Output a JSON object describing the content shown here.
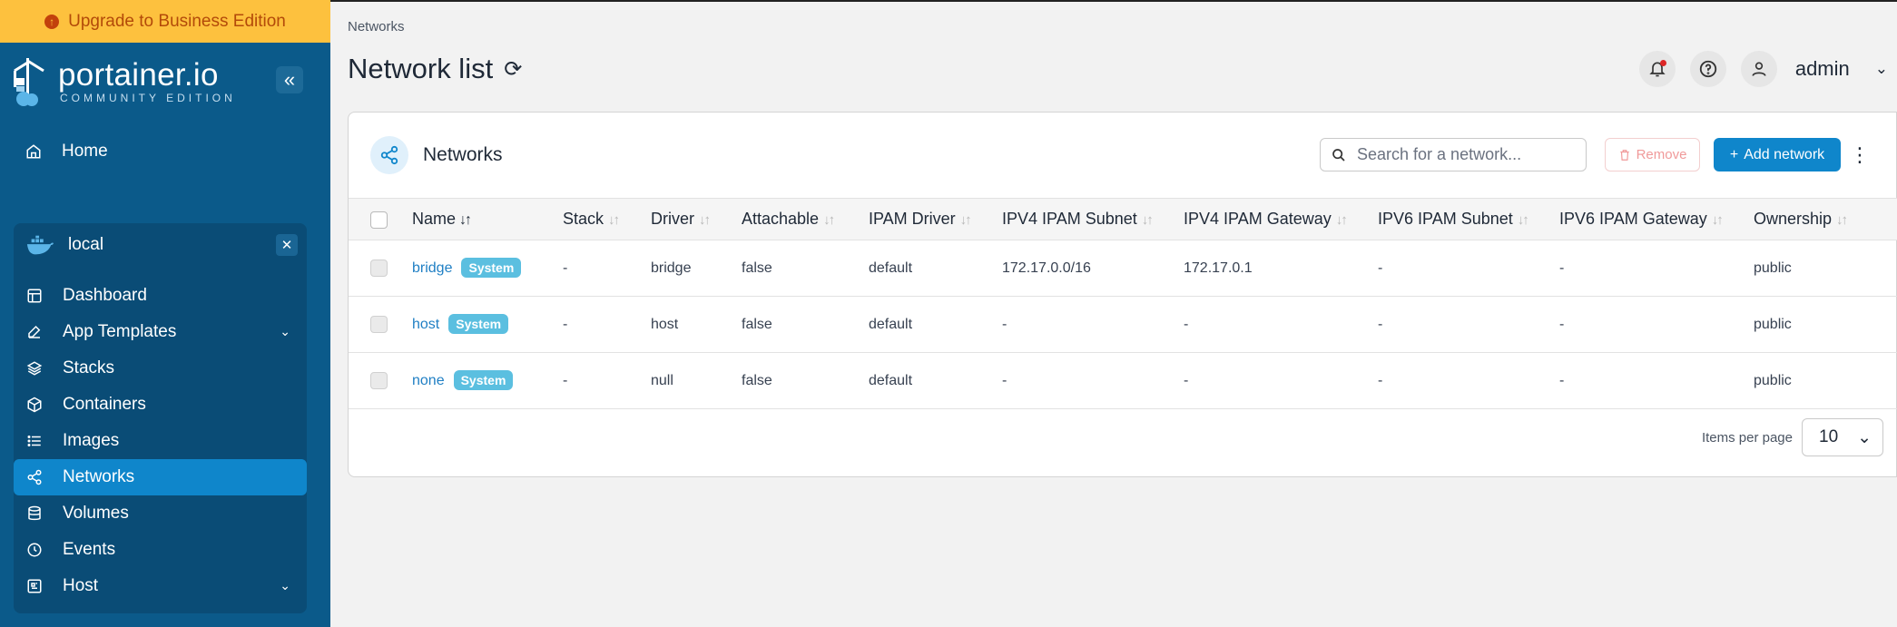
{
  "sidebar": {
    "upgrade_label": "Upgrade to Business Edition",
    "logo_main": "portainer.io",
    "logo_sub": "COMMUNITY EDITION",
    "home_label": "Home",
    "environment": {
      "name": "local",
      "items": [
        {
          "label": "Dashboard"
        },
        {
          "label": "App Templates"
        },
        {
          "label": "Stacks"
        },
        {
          "label": "Containers"
        },
        {
          "label": "Images"
        },
        {
          "label": "Networks"
        },
        {
          "label": "Volumes"
        },
        {
          "label": "Events"
        },
        {
          "label": "Host"
        }
      ]
    }
  },
  "header": {
    "breadcrumb": "Networks",
    "title": "Network list",
    "user": "admin"
  },
  "card": {
    "title": "Networks",
    "search_placeholder": "Search for a network...",
    "remove_label": "Remove",
    "add_label": "Add network"
  },
  "table": {
    "columns": [
      "Name",
      "Stack",
      "Driver",
      "Attachable",
      "IPAM Driver",
      "IPV4 IPAM Subnet",
      "IPV4 IPAM Gateway",
      "IPV6 IPAM Subnet",
      "IPV6 IPAM Gateway",
      "Ownership"
    ],
    "rows": [
      {
        "name": "bridge",
        "badge": "System",
        "stack": "-",
        "driver": "bridge",
        "attachable": "false",
        "ipam_driver": "default",
        "ipv4_subnet": "172.17.0.0/16",
        "ipv4_gateway": "172.17.0.1",
        "ipv6_subnet": "-",
        "ipv6_gateway": "-",
        "ownership": "public"
      },
      {
        "name": "host",
        "badge": "System",
        "stack": "-",
        "driver": "host",
        "attachable": "false",
        "ipam_driver": "default",
        "ipv4_subnet": "-",
        "ipv4_gateway": "-",
        "ipv6_subnet": "-",
        "ipv6_gateway": "-",
        "ownership": "public"
      },
      {
        "name": "none",
        "badge": "System",
        "stack": "-",
        "driver": "null",
        "attachable": "false",
        "ipam_driver": "default",
        "ipv4_subnet": "-",
        "ipv4_gateway": "-",
        "ipv6_subnet": "-",
        "ipv6_gateway": "-",
        "ownership": "public"
      }
    ]
  },
  "pagination": {
    "label": "Items per page",
    "value": "10"
  },
  "colors": {
    "sidebar_bg": "#0b5a8a",
    "env_bg": "#0a4c76",
    "active_item": "#0f86cb",
    "upgrade_bg": "#fdc13e",
    "primary": "#0f86cb",
    "badge": "#5bbfe0",
    "link": "#1f7fc4"
  }
}
